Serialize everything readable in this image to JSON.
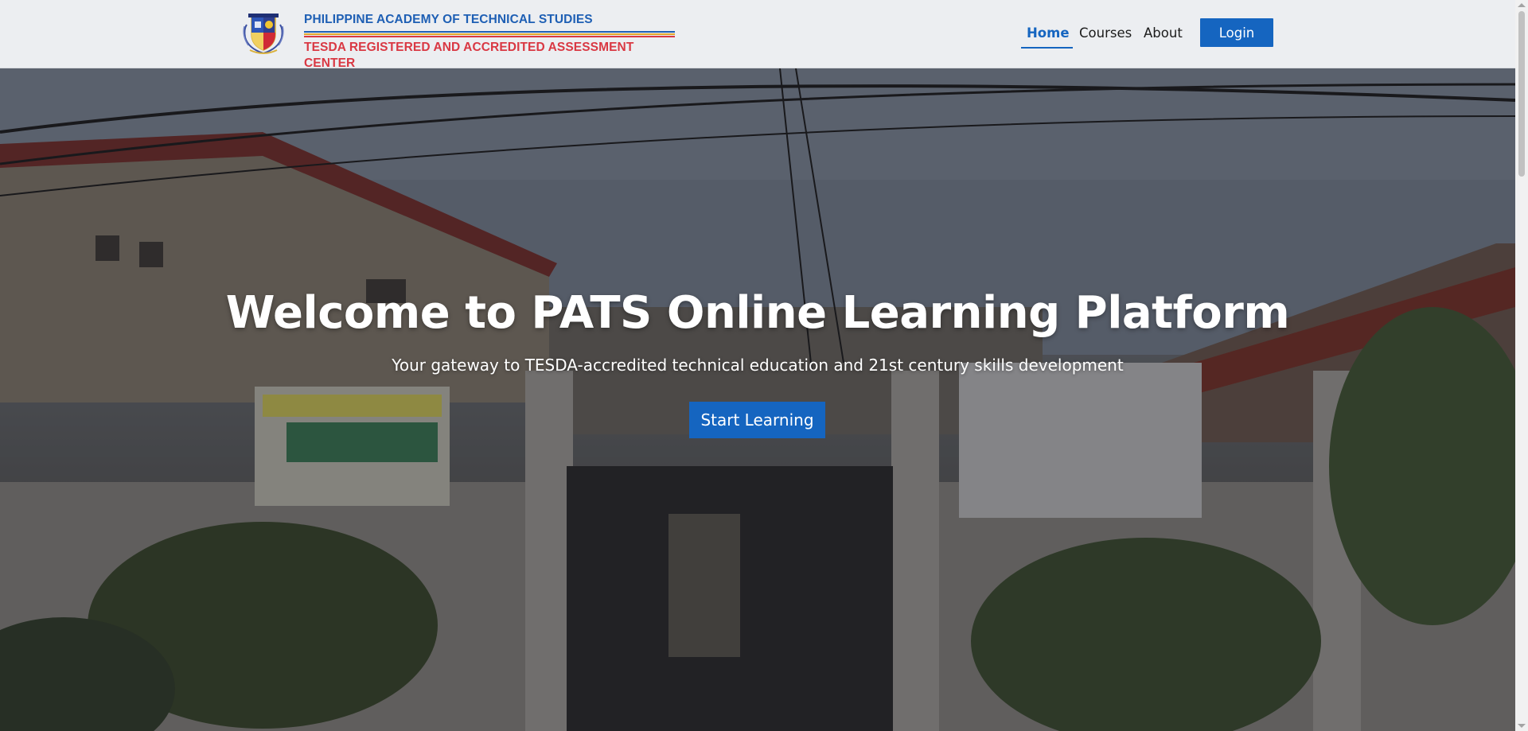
{
  "header": {
    "org_name": "PHILIPPINE ACADEMY OF TECHNICAL STUDIES",
    "tagline": "TESDA REGISTERED AND ACCREDITED ASSESSMENT CENTER",
    "logo_icon": "academy-crest-icon"
  },
  "nav": {
    "home": "Home",
    "courses": "Courses",
    "about": "About",
    "login": "Login",
    "active": "Home"
  },
  "hero": {
    "title": "Welcome to PATS Online Learning Platform",
    "subtitle": "Your gateway to TESDA-accredited technical education and 21st century skills development",
    "cta": "Start Learning"
  },
  "colors": {
    "primary": "#1565c0",
    "brand_blue": "#1e5fb4",
    "brand_red": "#d93843",
    "brand_gold": "#e3a82b",
    "header_bg": "#eceef1"
  }
}
